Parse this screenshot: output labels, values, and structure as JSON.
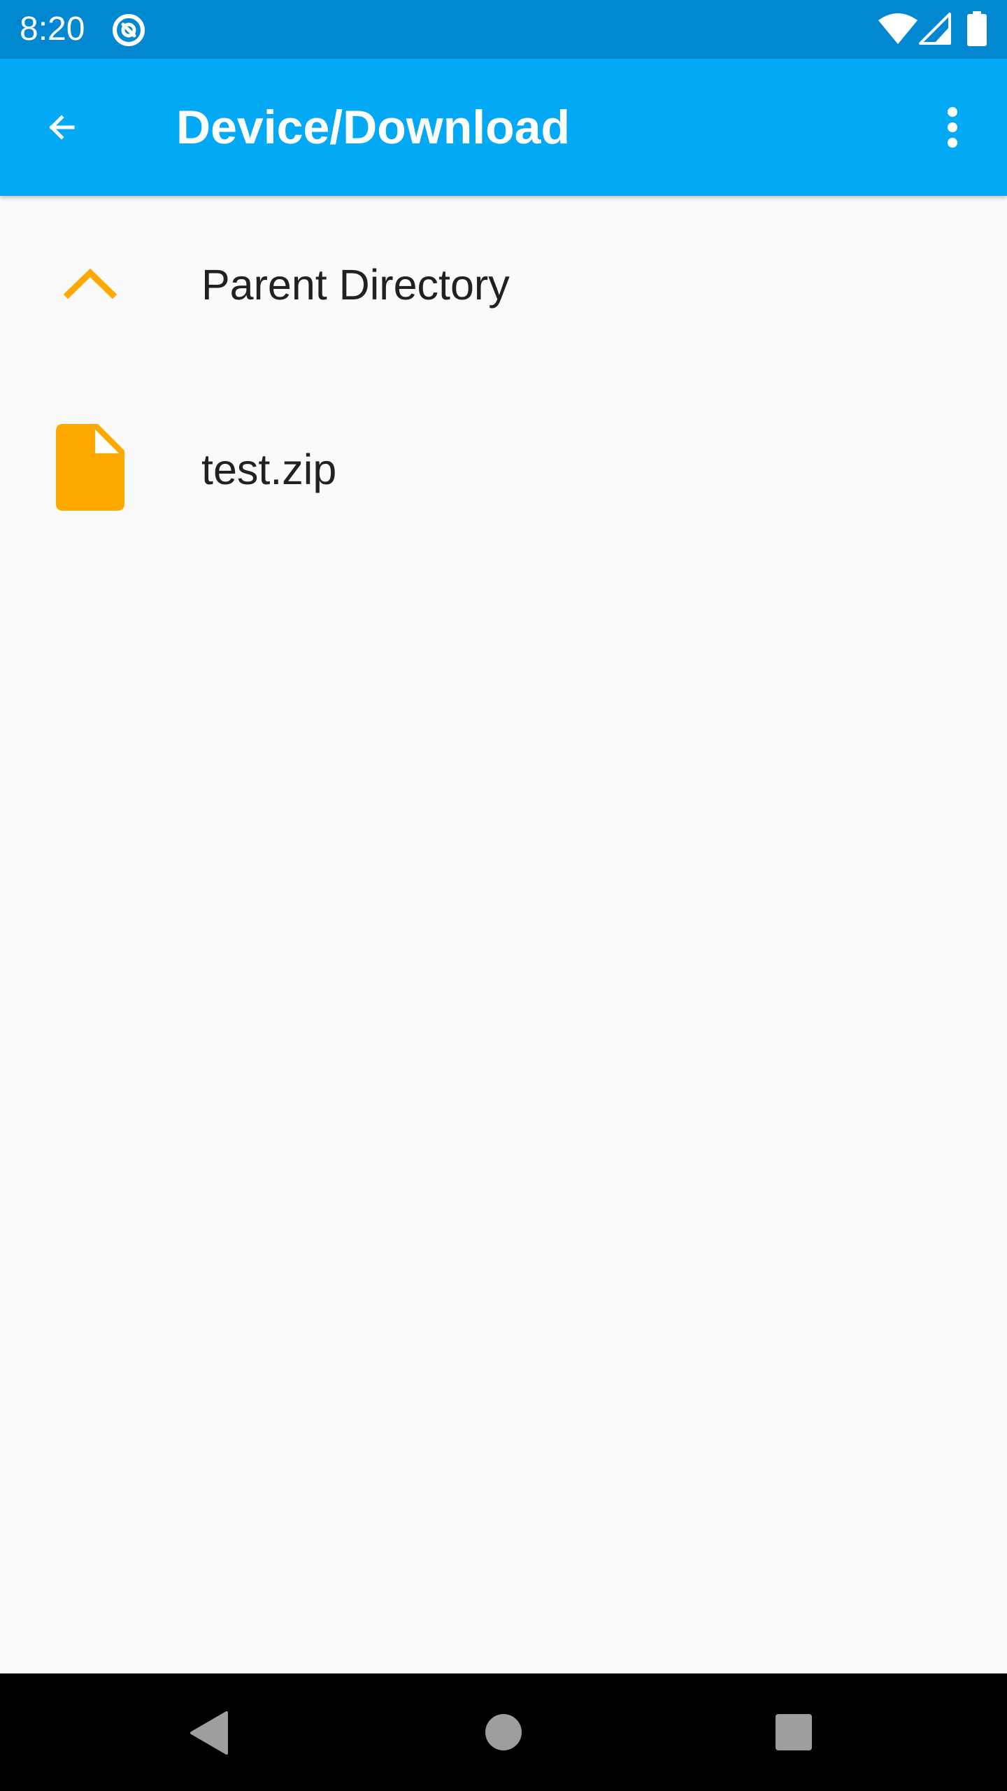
{
  "status_bar": {
    "time": "8:20",
    "icons": [
      "data-saver-icon",
      "wifi-icon",
      "cellular-signal-icon",
      "battery-icon"
    ]
  },
  "app_bar": {
    "title": "Device/Download",
    "back_icon": "arrow-back-icon",
    "menu_icon": "more-vert-icon",
    "color": "#03a9f4"
  },
  "file_list": {
    "items": [
      {
        "label": "Parent Directory",
        "icon": "chevron-up-icon"
      },
      {
        "label": "test.zip",
        "icon": "file-icon"
      }
    ],
    "icon_color": "#ffa800"
  },
  "nav_bar": {
    "buttons": [
      "back-triangle-icon",
      "home-circle-icon",
      "recents-square-icon"
    ]
  },
  "colors": {
    "status_bar": "#0288d1",
    "app_bar": "#03a9f4",
    "accent": "#ffa800",
    "background": "#fafafa"
  }
}
